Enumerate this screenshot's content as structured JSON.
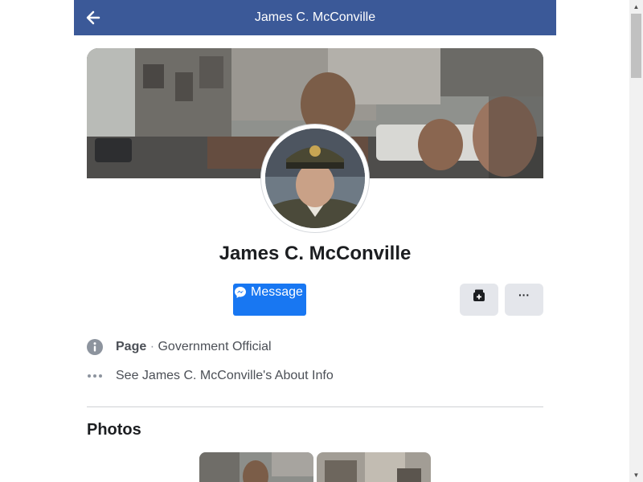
{
  "header": {
    "title": "James C. McConville",
    "back_icon": "arrow-left-icon",
    "background_color": "#3b5998"
  },
  "profile": {
    "name": "James C. McConville",
    "cover_description": "cover-photo",
    "avatar_description": "profile-picture"
  },
  "actions": {
    "message_label": "Message",
    "message_icon": "messenger-icon",
    "message_color": "#1877f2",
    "save_icon": "save-icon",
    "more_label": "···",
    "more_icon": "more-options-icon"
  },
  "info": {
    "page_kind": "Page",
    "separator": "·",
    "category": "Government Official",
    "about_link": "See James C. McConville's About Info",
    "category_icon": "info-circle-icon",
    "about_icon": "ellipsis-icon"
  },
  "photos": {
    "title": "Photos",
    "items": [
      {
        "icon": "photo-thumbnail"
      },
      {
        "icon": "photo-thumbnail"
      }
    ]
  },
  "scrollbar": {
    "up_label": "▲",
    "down_label": "▼"
  }
}
